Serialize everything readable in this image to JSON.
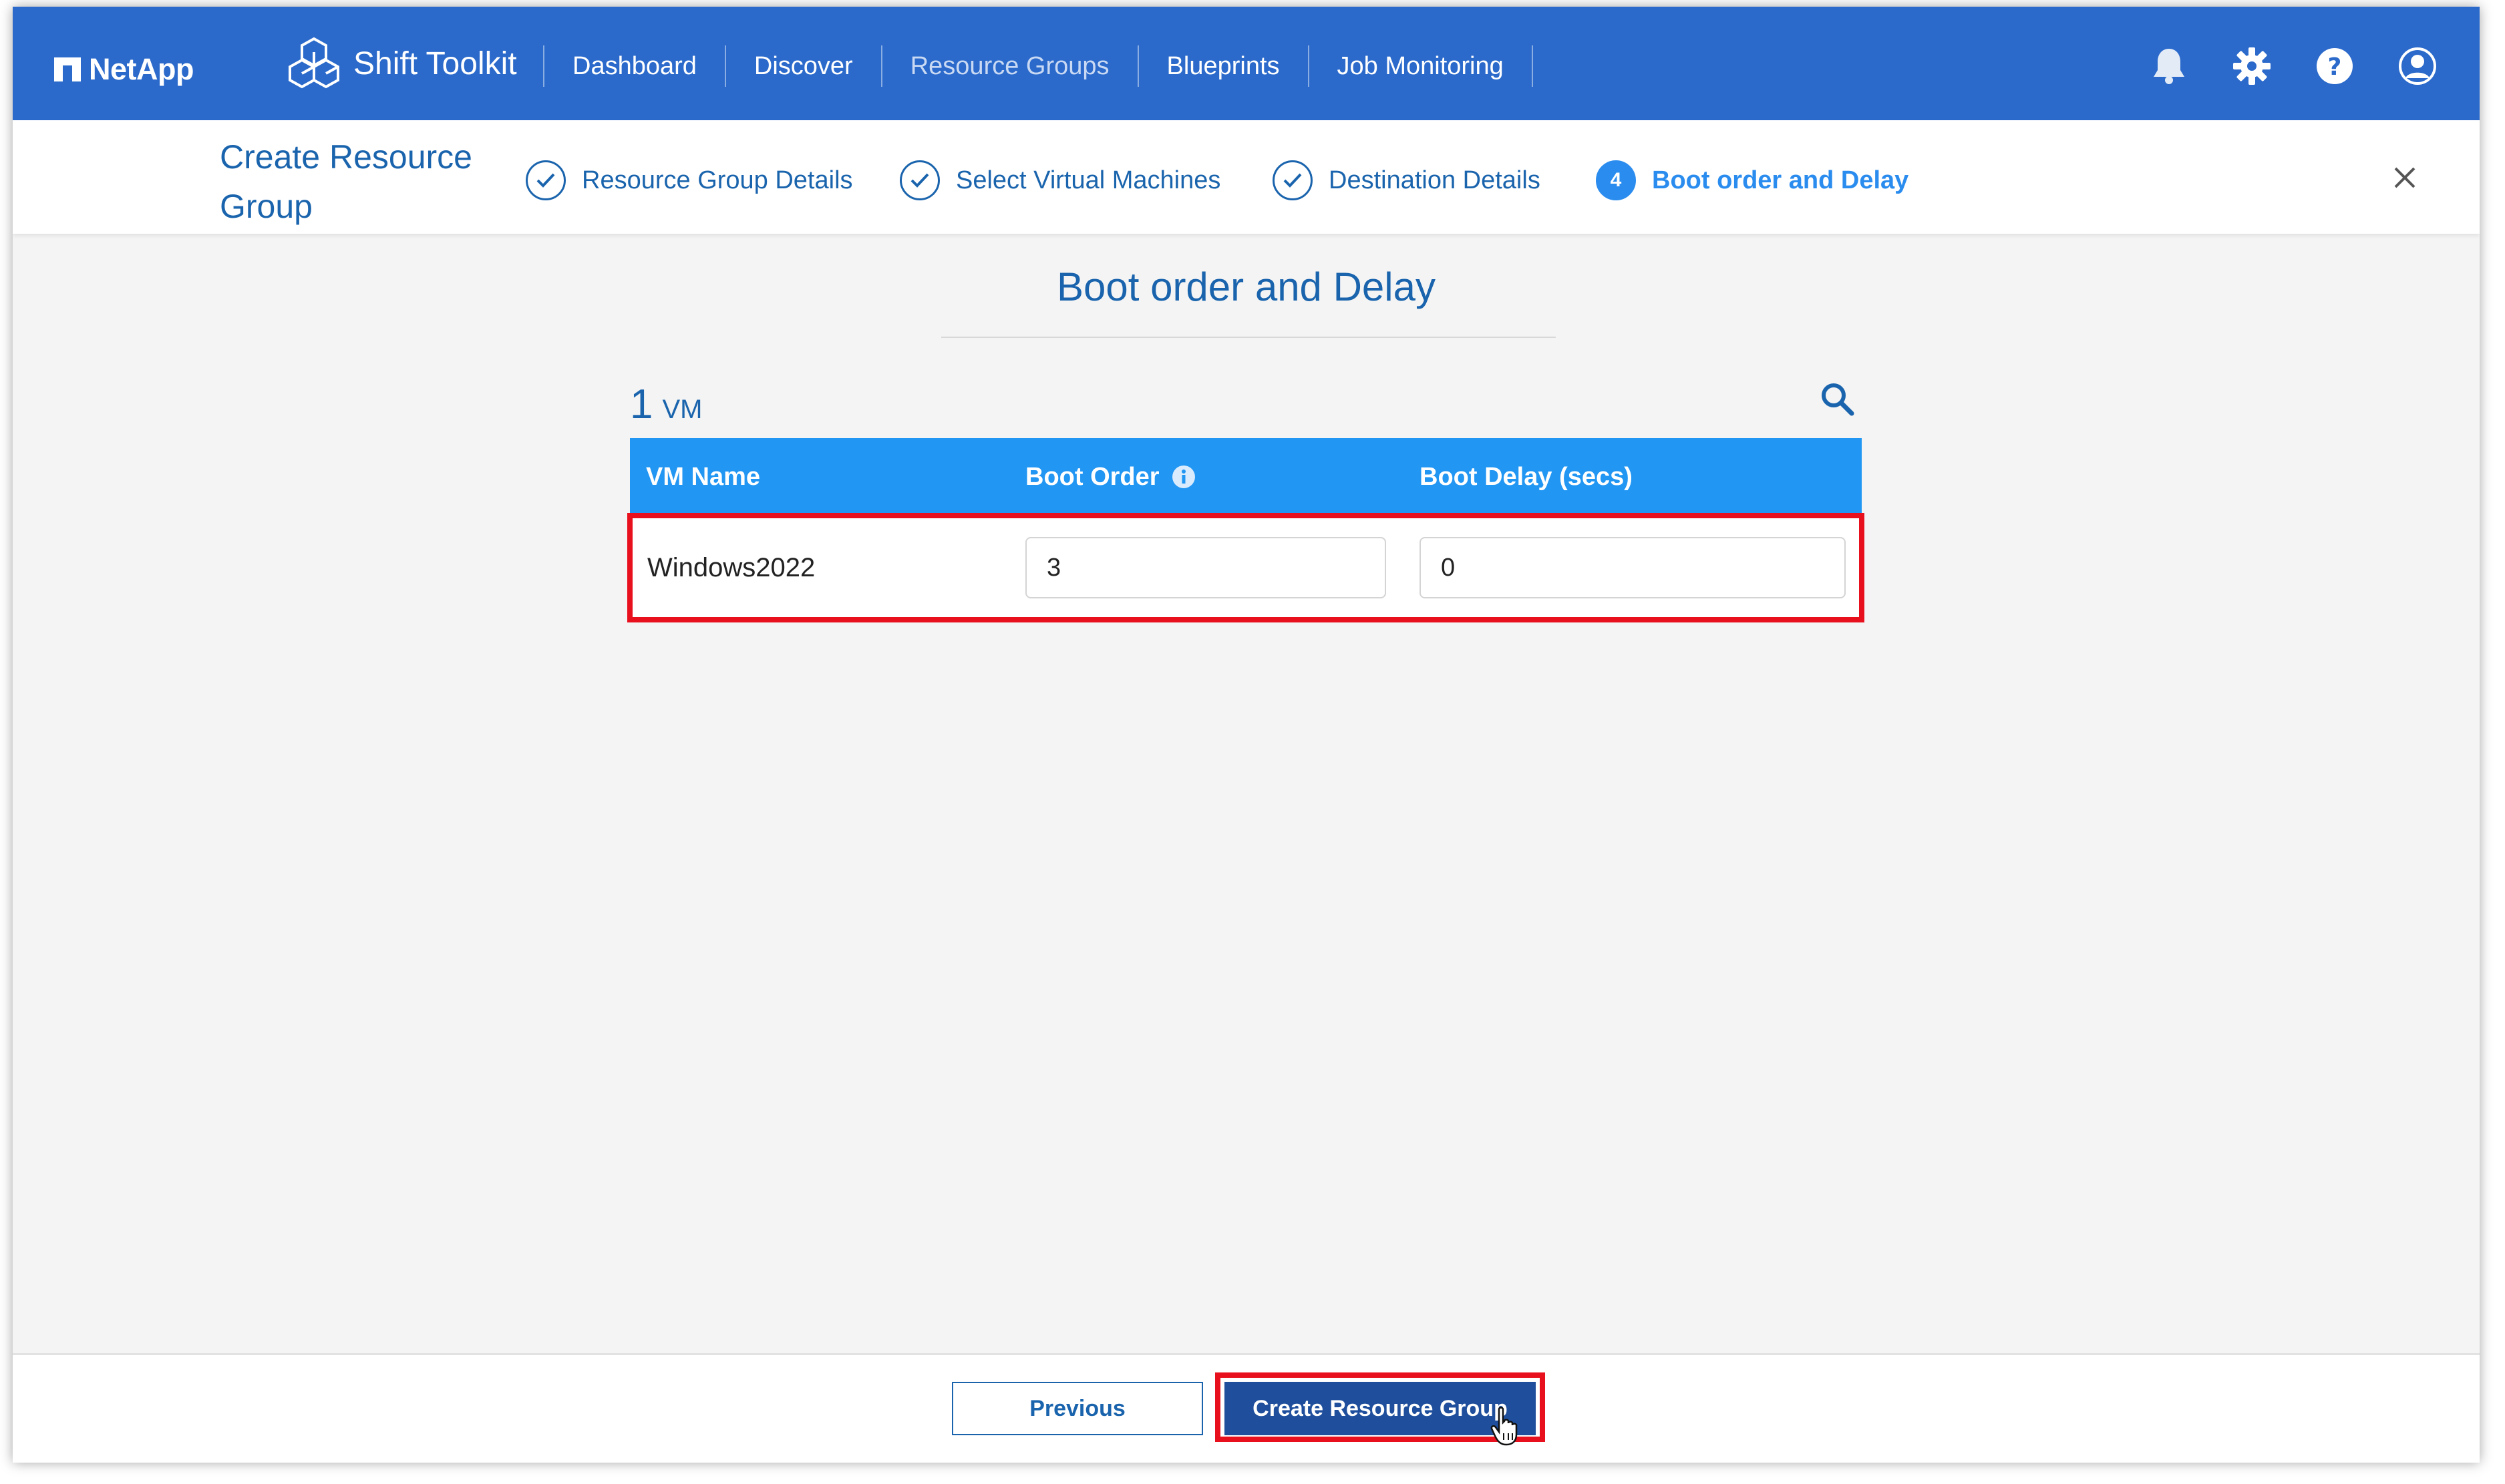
{
  "brand": {
    "name": "NetApp",
    "product": "Shift Toolkit"
  },
  "nav": {
    "items": [
      {
        "label": "Dashboard"
      },
      {
        "label": "Discover"
      },
      {
        "label": "Resource Groups"
      },
      {
        "label": "Blueprints"
      },
      {
        "label": "Job Monitoring"
      }
    ],
    "active": "Resource Groups",
    "icons": [
      "bell-icon",
      "gear-icon",
      "help-icon",
      "user-icon"
    ]
  },
  "wizard": {
    "title": "Create Resource Group",
    "steps": [
      {
        "label": "Resource Group Details",
        "status": "complete"
      },
      {
        "label": "Select Virtual Machines",
        "status": "complete"
      },
      {
        "label": "Destination Details",
        "status": "complete"
      },
      {
        "label": "Boot order and Delay",
        "status": "current",
        "number": "4"
      }
    ]
  },
  "main": {
    "title": "Boot order and Delay",
    "vm_count": "1",
    "vm_unit": "VM",
    "table": {
      "headers": {
        "name": "VM Name",
        "order": "Boot Order",
        "delay": "Boot Delay (secs)"
      },
      "rows": [
        {
          "name": "Windows2022",
          "boot_order": "3",
          "boot_delay": "0"
        }
      ]
    }
  },
  "footer": {
    "previous": "Previous",
    "create": "Create Resource Group"
  },
  "colors": {
    "topbar": "#2b6acb",
    "accent": "#1a64ad",
    "table_header": "#2196f3",
    "highlight": "#e8101c",
    "primary_button": "#1f4f9c"
  }
}
